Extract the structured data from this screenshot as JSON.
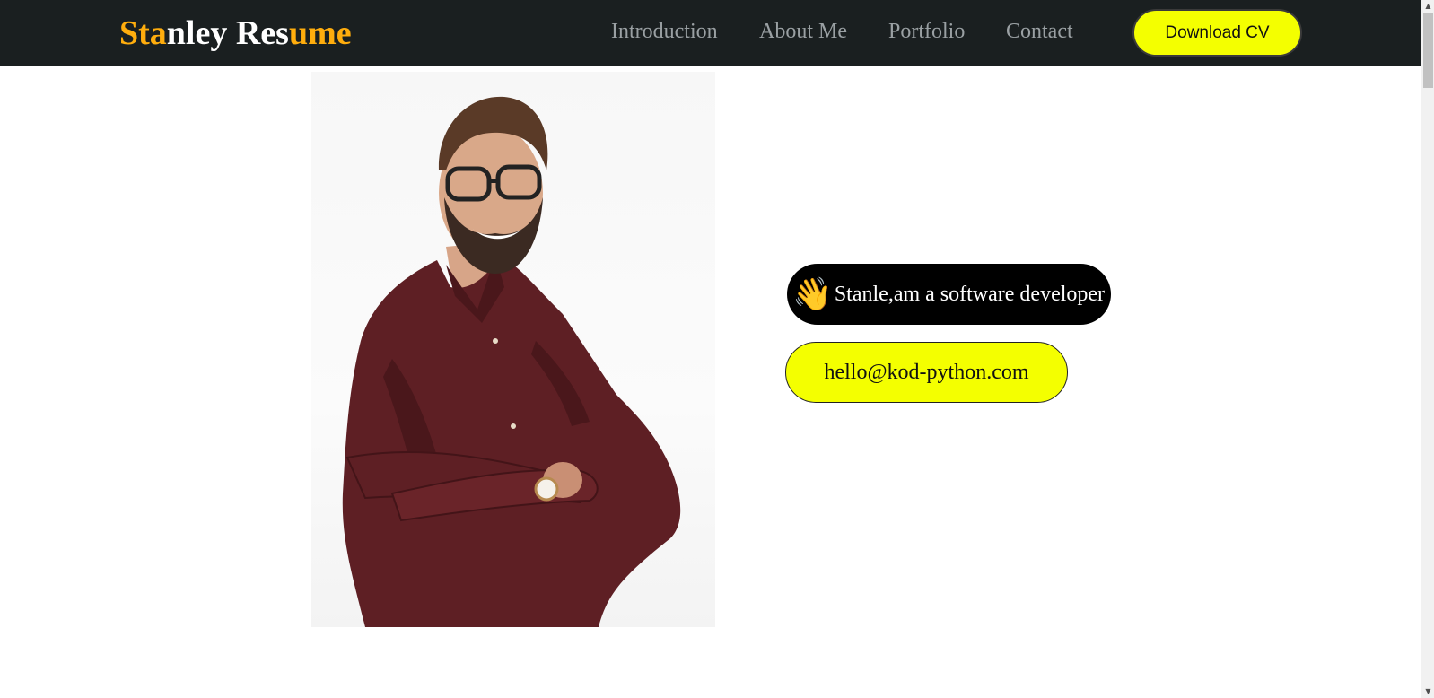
{
  "header": {
    "logo": {
      "parts": [
        "Sta",
        "nley",
        " ",
        "Res",
        "ume"
      ]
    },
    "nav": [
      "Introduction",
      "About Me",
      "Portfolio",
      "Contact"
    ],
    "download_label": "Download CV"
  },
  "hero": {
    "wave_emoji": "👋",
    "greeting": "Stanle,am a software developer",
    "email": "hello@kod-python.com"
  },
  "colors": {
    "navbar_bg": "#1a1f20",
    "logo_accent": "#ffad0d",
    "button_yellow": "#f4ff00",
    "greeting_pill": "#000000",
    "shirt": "#5e1f24"
  },
  "icons": {
    "scroll_up": "▲",
    "scroll_down": "▼"
  }
}
